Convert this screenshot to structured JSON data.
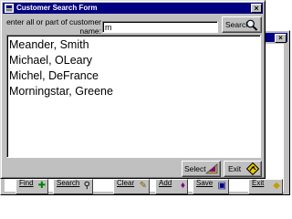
{
  "dialog": {
    "title": "Customer Search Form",
    "close_glyph": "×",
    "prompt": "enter all or part of customer name:",
    "search_value": "m",
    "search_label": "Search",
    "select_label": "Select",
    "exit_label": "Exit"
  },
  "results": [
    "Meander, Smith",
    "Michael, OLeary",
    "Michel, DeFrance",
    "Morningstar, Greene"
  ],
  "background_window": {
    "close_glyph": "×",
    "toolbar": [
      {
        "label": "Find",
        "icon": "find-icon"
      },
      {
        "label": "Search",
        "icon": "magnifier-icon"
      },
      {
        "label": "Clear",
        "icon": "eraser-icon"
      },
      {
        "label": "Add",
        "icon": "add-icon"
      },
      {
        "label": "Save",
        "icon": "save-icon"
      },
      {
        "label": "Exit",
        "icon": "exit-icon"
      }
    ]
  }
}
